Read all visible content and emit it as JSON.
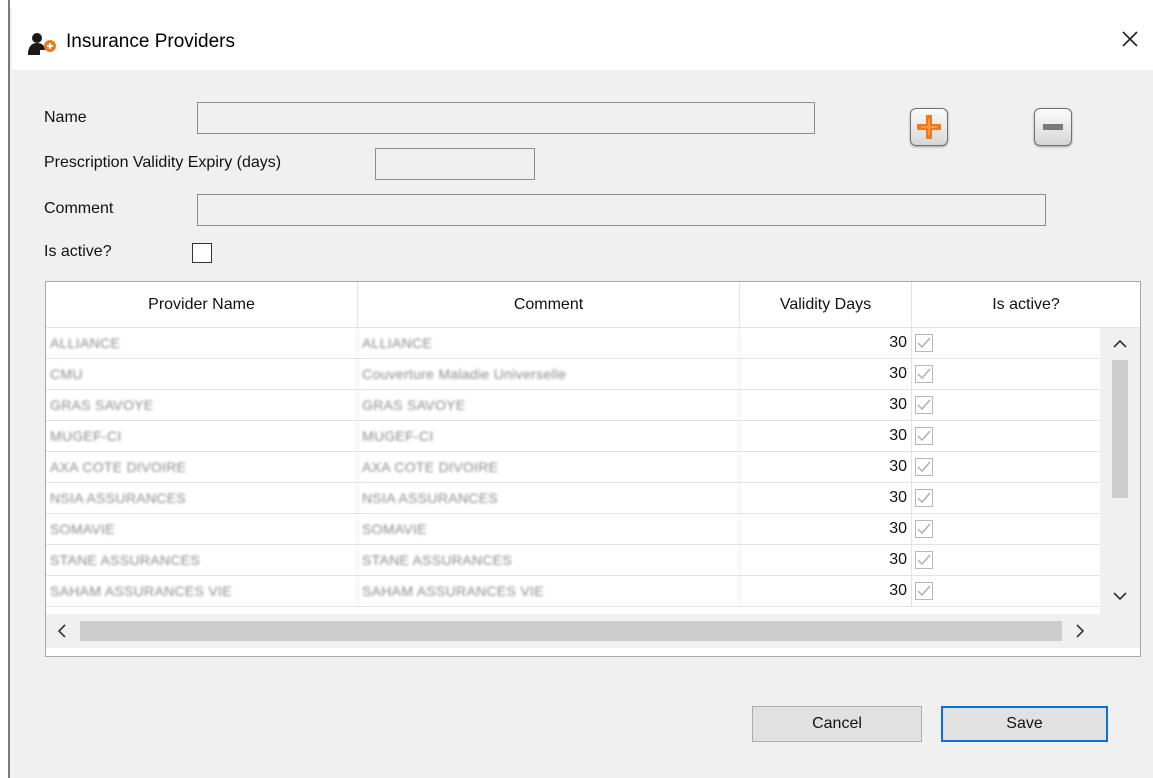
{
  "window": {
    "title": "Insurance Providers",
    "close_glyph": "✕"
  },
  "form": {
    "name_label": "Name",
    "name_value": "",
    "validity_label": "Prescription Validity Expiry (days)",
    "validity_value": "",
    "comment_label": "Comment",
    "comment_value": "",
    "active_label": "Is active?",
    "active_checked": false,
    "add_icon": "plus-icon",
    "remove_icon": "minus-icon"
  },
  "table": {
    "columns": [
      "Provider Name",
      "Comment",
      "Validity Days",
      "Is active?"
    ],
    "rows": [
      {
        "name": "ALLIANCE",
        "comment": "ALLIANCE",
        "days": "30",
        "active": true
      },
      {
        "name": "CMU",
        "comment": "Couverture Maladie Universelle",
        "days": "30",
        "active": true
      },
      {
        "name": "GRAS SAVOYE",
        "comment": "GRAS SAVOYE",
        "days": "30",
        "active": true
      },
      {
        "name": "MUGEF-CI",
        "comment": "MUGEF-CI",
        "days": "30",
        "active": true
      },
      {
        "name": "AXA COTE DIVOIRE",
        "comment": "AXA COTE DIVOIRE",
        "days": "30",
        "active": true
      },
      {
        "name": "NSIA ASSURANCES",
        "comment": "NSIA ASSURANCES",
        "days": "30",
        "active": true
      },
      {
        "name": "SOMAVIE",
        "comment": "SOMAVIE",
        "days": "30",
        "active": true
      },
      {
        "name": "STANE ASSURANCES",
        "comment": "STANE ASSURANCES",
        "days": "30",
        "active": true
      },
      {
        "name": "SAHAM ASSURANCES VIE",
        "comment": "SAHAM ASSURANCES VIE",
        "days": "30",
        "active": true
      }
    ],
    "scroll_up": "^",
    "scroll_down": "v",
    "scroll_left": "<",
    "scroll_right": ">"
  },
  "buttons": {
    "cancel": "Cancel",
    "save": "Save"
  },
  "colors": {
    "accent": "#0a6fd6",
    "add_orange": "#f07a1a"
  }
}
